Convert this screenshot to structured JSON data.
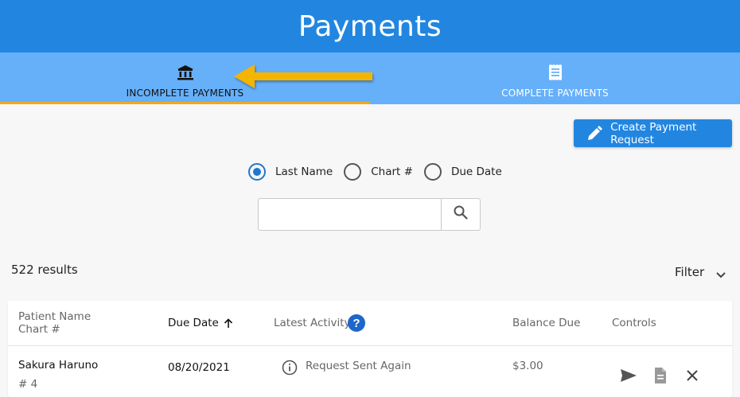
{
  "header": {
    "title": "Payments"
  },
  "tabs": [
    {
      "label": "INCOMPLETE PAYMENTS",
      "icon": "bank-icon",
      "active": true
    },
    {
      "label": "COMPLETE PAYMENTS",
      "icon": "receipt-icon",
      "active": false
    }
  ],
  "annotation": {
    "icon": "arrow-left-icon",
    "color": "#f5b400"
  },
  "toolbar": {
    "create_label": "Create Payment Request",
    "create_icon": "pencil-icon"
  },
  "search_by": {
    "options": [
      "Last Name",
      "Chart #",
      "Due Date"
    ],
    "selected": "Last Name"
  },
  "search": {
    "value": "",
    "placeholder": "",
    "icon": "search-icon"
  },
  "results": {
    "count_text": "522 results"
  },
  "filter": {
    "label": "Filter",
    "icon": "chevron-down-icon"
  },
  "table": {
    "columns": {
      "patient_name": "Patient Name",
      "chart": "Chart #",
      "due_date": "Due Date",
      "latest_activity": "Latest Activity",
      "balance_due": "Balance Due",
      "controls": "Controls"
    },
    "sort": {
      "column": "Due Date",
      "direction": "ascending",
      "icon": "arrow-up-icon"
    },
    "help_icon_text": "?",
    "rows": [
      {
        "patient_name": "Sakura Haruno",
        "chart": "# 4",
        "due_date": "08/20/2021",
        "latest_activity": "Request Sent Again",
        "balance_due": "$3.00",
        "controls": [
          "send-icon",
          "document-icon",
          "close-icon"
        ]
      }
    ]
  },
  "colors": {
    "primary": "#2286e0",
    "tab_bar": "#66b0fa",
    "tab_underline": "#f1a81a",
    "radio_checked": "#2277cc"
  }
}
